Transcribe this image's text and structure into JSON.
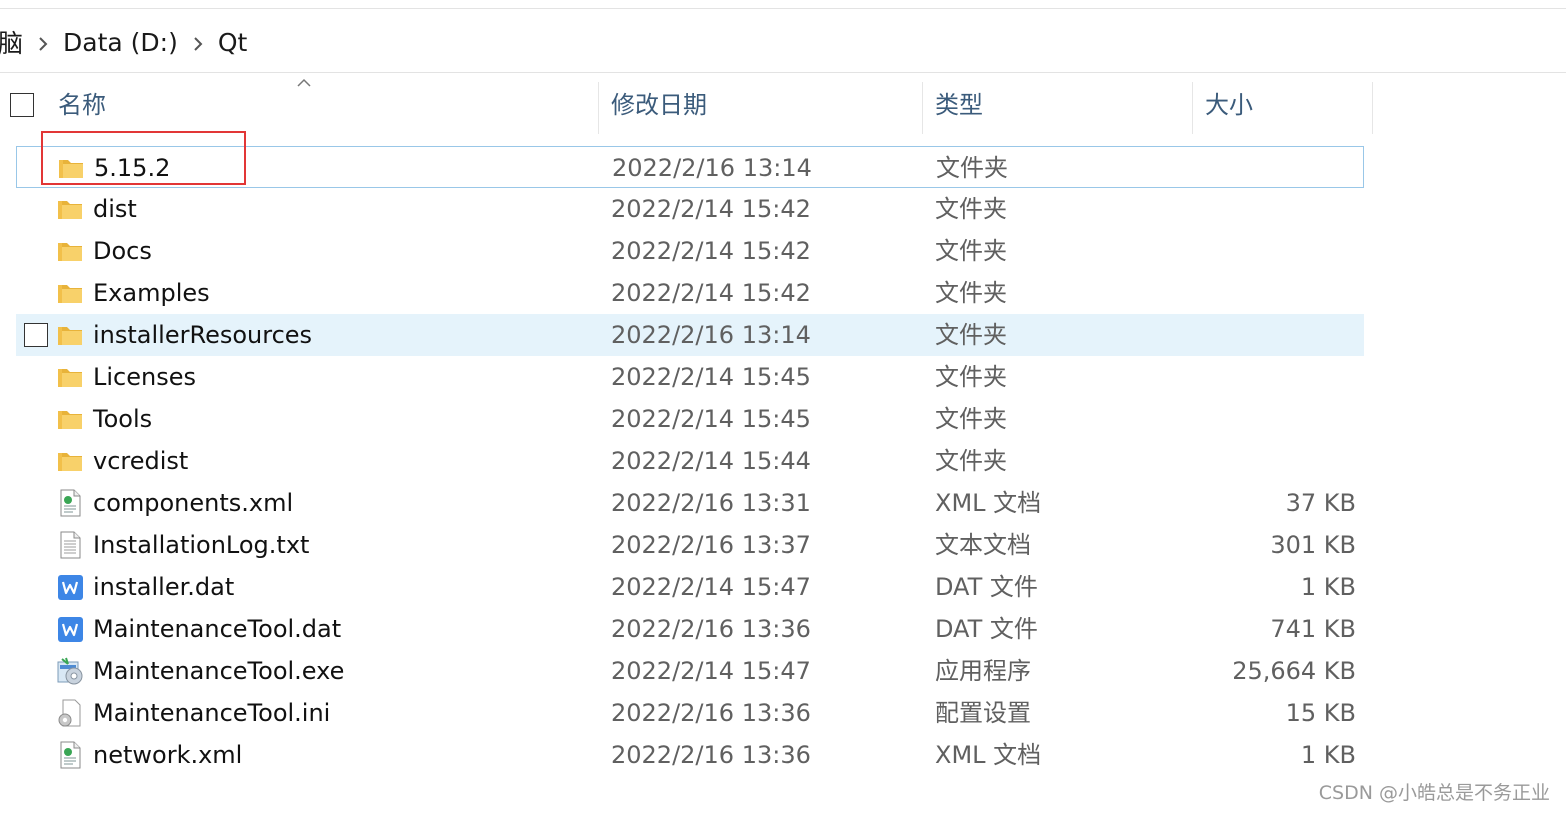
{
  "breadcrumb": {
    "items": [
      "脑",
      "Data (D:)",
      "Qt"
    ]
  },
  "header": {
    "name": "名称",
    "date": "修改日期",
    "type": "类型",
    "size": "大小"
  },
  "files": [
    {
      "name": "5.15.2",
      "date": "2022/2/16 13:14",
      "type": "文件夹",
      "size": "",
      "icon": "folder-icon"
    },
    {
      "name": "dist",
      "date": "2022/2/14 15:42",
      "type": "文件夹",
      "size": "",
      "icon": "folder-icon"
    },
    {
      "name": "Docs",
      "date": "2022/2/14 15:42",
      "type": "文件夹",
      "size": "",
      "icon": "folder-icon"
    },
    {
      "name": "Examples",
      "date": "2022/2/14 15:42",
      "type": "文件夹",
      "size": "",
      "icon": "folder-icon"
    },
    {
      "name": "installerResources",
      "date": "2022/2/16 13:14",
      "type": "文件夹",
      "size": "",
      "icon": "folder-icon"
    },
    {
      "name": "Licenses",
      "date": "2022/2/14 15:45",
      "type": "文件夹",
      "size": "",
      "icon": "folder-icon"
    },
    {
      "name": "Tools",
      "date": "2022/2/14 15:45",
      "type": "文件夹",
      "size": "",
      "icon": "folder-icon"
    },
    {
      "name": "vcredist",
      "date": "2022/2/14 15:44",
      "type": "文件夹",
      "size": "",
      "icon": "folder-icon"
    },
    {
      "name": "components.xml",
      "date": "2022/2/16 13:31",
      "type": "XML 文档",
      "size": "37 KB",
      "icon": "xml-file-icon"
    },
    {
      "name": "InstallationLog.txt",
      "date": "2022/2/16 13:37",
      "type": "文本文档",
      "size": "301 KB",
      "icon": "text-file-icon"
    },
    {
      "name": "installer.dat",
      "date": "2022/2/14 15:47",
      "type": "DAT 文件",
      "size": "1 KB",
      "icon": "wps-file-icon"
    },
    {
      "name": "MaintenanceTool.dat",
      "date": "2022/2/16 13:36",
      "type": "DAT 文件",
      "size": "741 KB",
      "icon": "wps-file-icon"
    },
    {
      "name": "MaintenanceTool.exe",
      "date": "2022/2/14 15:47",
      "type": "应用程序",
      "size": "25,664 KB",
      "icon": "installer-exe-icon"
    },
    {
      "name": "MaintenanceTool.ini",
      "date": "2022/2/16 13:36",
      "type": "配置设置",
      "size": "15 KB",
      "icon": "ini-file-icon"
    },
    {
      "name": "network.xml",
      "date": "2022/2/16 13:36",
      "type": "XML 文档",
      "size": "1 KB",
      "icon": "xml-file-icon"
    }
  ],
  "watermark": "CSDN @小皓总是不务正业",
  "colors": {
    "selection_outline": "#99c7e8",
    "hover_background": "#e5f3fb",
    "highlight_box": "#e23636",
    "header_text": "#3b5b7b",
    "folder": "#f5c542"
  }
}
